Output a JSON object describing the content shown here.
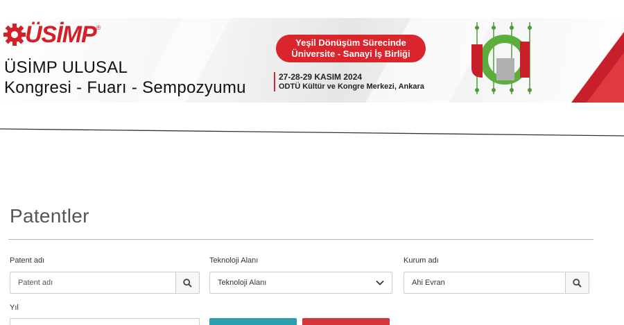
{
  "banner": {
    "logo": "ÜSİMP",
    "title_line1": "ÜSİMP ULUSAL",
    "title_line2": "Kongresi - Fuarı - Sempozyumu",
    "theme_line1": "Yeşil Dönüşüm Sürecinde",
    "theme_line2": "Üniversite - Sanayi İş Birliği",
    "date": "27-28-29 KASIM 2024",
    "venue": "ODTÜ Kültür ve Kongre Merkezi, Ankara",
    "accent_color": "#d9252b"
  },
  "page": {
    "title": "Patentler"
  },
  "filters": {
    "patent_name": {
      "label": "Patent adı",
      "placeholder": "Patent adı",
      "value": ""
    },
    "technology_area": {
      "label": "Teknoloji Alanı",
      "selected": "Teknoloji Alanı"
    },
    "institution": {
      "label": "Kurum adı",
      "value": "Ahi Evran"
    },
    "year": {
      "label": "Yıl"
    }
  },
  "buttons": {
    "primary_color": "#2a9fae",
    "secondary_color": "#d4353b"
  }
}
